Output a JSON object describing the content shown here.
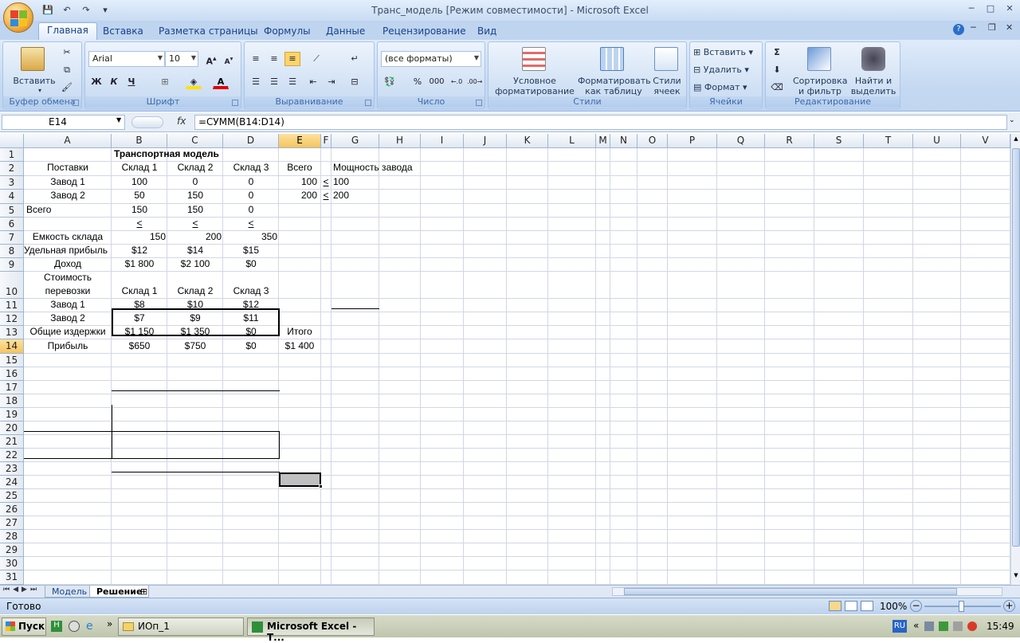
{
  "window": {
    "title": "Транс_модель  [Режим совместимости] - Microsoft Excel",
    "minimize": "─",
    "maximize": "□",
    "close": "✕"
  },
  "ribbon_tabs": [
    "Главная",
    "Вставка",
    "Разметка страницы",
    "Формулы",
    "Данные",
    "Рецензирование",
    "Вид"
  ],
  "groups": {
    "clipboard": {
      "label": "Буфер обмена",
      "paste": "Вставить"
    },
    "font": {
      "label": "Шрифт",
      "name": "Arial",
      "size": "10",
      "bold": "Ж",
      "italic": "К",
      "underline": "Ч"
    },
    "alignment": {
      "label": "Выравнивание"
    },
    "number": {
      "label": "Число",
      "format": "(все форматы)",
      "percent": "%",
      "thousands": "000"
    },
    "styles": {
      "label": "Стили",
      "conditional": "Условное форматирование",
      "as_table": "Форматировать как таблицу",
      "cell_styles": "Стили ячеек"
    },
    "cells": {
      "label": "Ячейки",
      "insert": "Вставить",
      "delete": "Удалить",
      "format": "Формат"
    },
    "editing": {
      "label": "Редактирование",
      "sort": "Сортировка и фильтр",
      "find": "Найти и выделить"
    }
  },
  "formula_bar": {
    "name_box": "E14",
    "fx": "fx",
    "formula": "=СУММ(B14:D14)"
  },
  "columns": [
    "A",
    "B",
    "C",
    "D",
    "E",
    "F",
    "G",
    "H",
    "I",
    "J",
    "K",
    "L",
    "M",
    "N",
    "O",
    "P",
    "Q",
    "R",
    "S",
    "T",
    "U",
    "V"
  ],
  "rows": [
    "1",
    "2",
    "3",
    "4",
    "5",
    "6",
    "7",
    "8",
    "9",
    "10",
    "11",
    "12",
    "13",
    "14",
    "15",
    "16",
    "17",
    "18",
    "19",
    "20",
    "21",
    "22",
    "23",
    "24",
    "25",
    "26",
    "27",
    "28",
    "29",
    "30",
    "31"
  ],
  "sheet": {
    "title": "Транспортная модель",
    "r2": {
      "a": "Поставки",
      "b": "Склад 1",
      "c": "Склад 2",
      "d": "Склад 3",
      "e": "Всего",
      "g": "Мощность завода"
    },
    "r3": {
      "a": "Завод 1",
      "b": "100",
      "c": "0",
      "d": "0",
      "e": "100",
      "f": "<",
      "g": "100"
    },
    "r4": {
      "a": "Завод 2",
      "b": "50",
      "c": "150",
      "d": "0",
      "e": "200",
      "f": "<",
      "g": "200"
    },
    "r5": {
      "a": "Всего",
      "b": "150",
      "c": "150",
      "d": "0"
    },
    "r6": {
      "b": "<",
      "c": "<",
      "d": "<"
    },
    "r7": {
      "a": "Емкость склада",
      "b": "150",
      "c": "200",
      "d": "350"
    },
    "r8": {
      "a": "Удельная прибыль",
      "b": "$12",
      "c": "$14",
      "d": "$15"
    },
    "r9": {
      "a": "Доход",
      "b": "$1 800",
      "c": "$2 100",
      "d": "$0"
    },
    "r10": {
      "a1": "Стоимость",
      "a2": "перевозки",
      "b": "Склад 1",
      "c": "Склад 2",
      "d": "Склад 3"
    },
    "r11": {
      "a": "Завод 1",
      "b": "$8",
      "c": "$10",
      "d": "$12"
    },
    "r12": {
      "a": "Завод 2",
      "b": "$7",
      "c": "$9",
      "d": "$11"
    },
    "r13": {
      "a": "Общие издержки",
      "b": "$1 150",
      "c": "$1 350",
      "d": "$0",
      "e": "Итого"
    },
    "r14": {
      "a": "Прибыль",
      "b": "$650",
      "c": "$750",
      "d": "$0",
      "e": "$1 400"
    }
  },
  "sheet_tabs": [
    "Модель",
    "Решение"
  ],
  "status": {
    "ready": "Готово",
    "zoom": "100%"
  },
  "taskbar": {
    "start": "Пуск",
    "folder": "ИОп_1",
    "excel": "Microsoft Excel - Т...",
    "lang": "RU",
    "time": "15:49"
  }
}
